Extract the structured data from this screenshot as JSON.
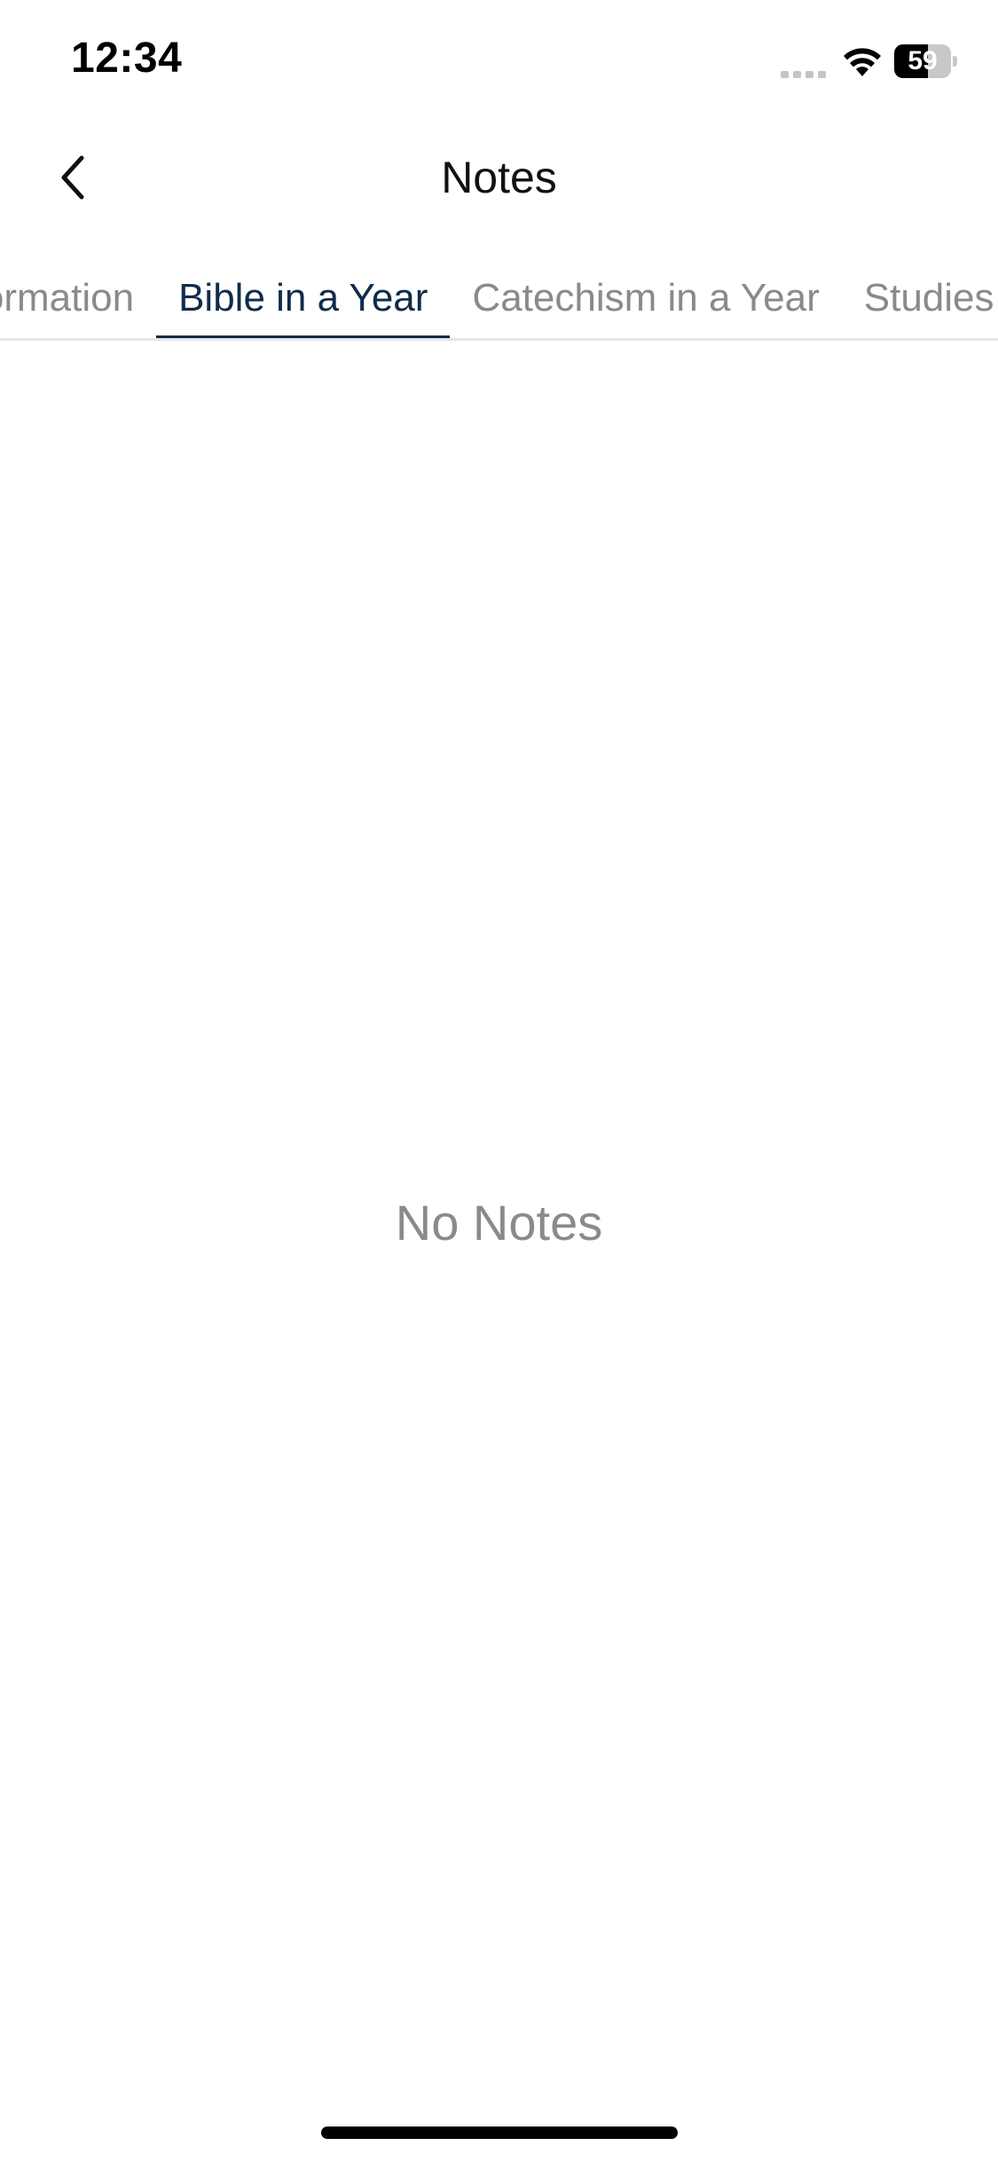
{
  "status_bar": {
    "time": "12:34",
    "battery_level": "59",
    "battery_fraction": 0.59
  },
  "header": {
    "title": "Notes",
    "back_icon": "chevron-left-icon"
  },
  "tabs": [
    {
      "label": "Formation",
      "active": false
    },
    {
      "label": "Bible in a Year",
      "active": true
    },
    {
      "label": "Catechism in a Year",
      "active": false
    },
    {
      "label": "Studies",
      "active": false
    }
  ],
  "empty_state": {
    "message": "No Notes"
  },
  "colors": {
    "accent": "#0f2c4a",
    "inactive_text": "#8a8a8a",
    "divider": "#e6e6e6"
  }
}
